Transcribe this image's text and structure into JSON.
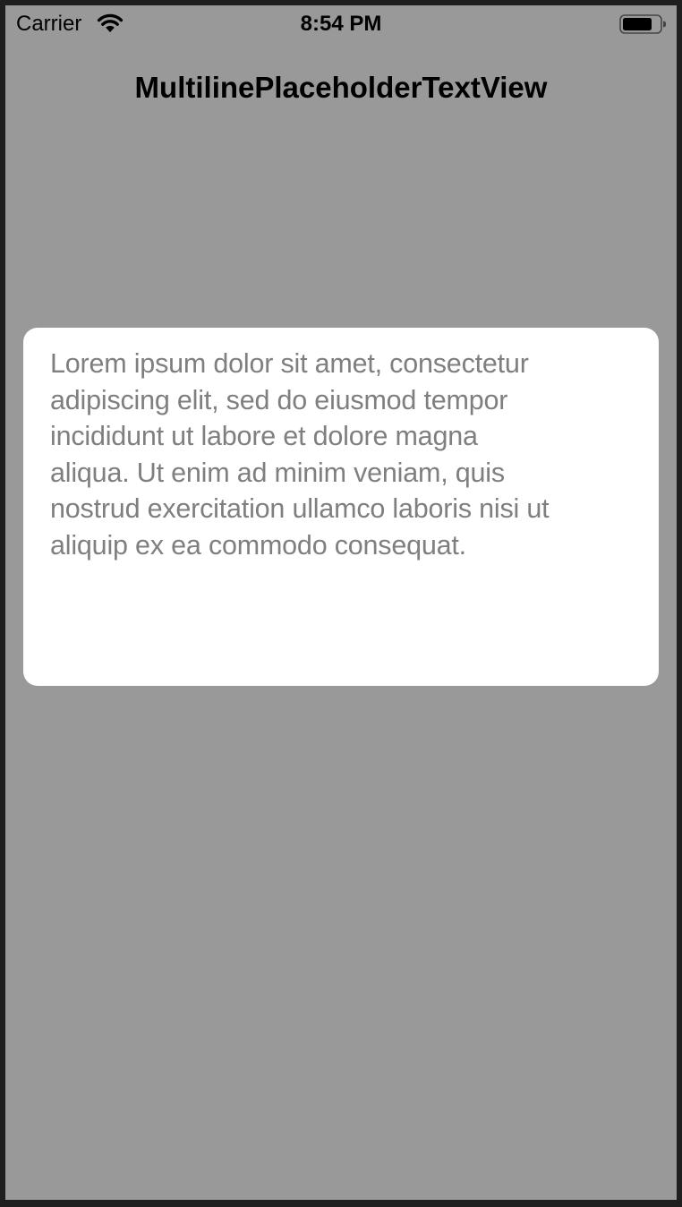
{
  "status_bar": {
    "carrier": "Carrier",
    "time": "8:54 PM",
    "wifi_icon": "wifi-icon",
    "battery_icon": "battery-icon"
  },
  "nav_bar": {
    "title": "MultilinePlaceholderTextView"
  },
  "text_view": {
    "text": "Lorem ipsum dolor sit amet, consectetur\nadipiscing elit, sed do eiusmod tempor\nincididunt ut labore et dolore magna\naliqua. Ut enim ad minim veniam, quis\nnostrud exercitation ullamco laboris nisi ut\naliquip ex ea commodo consequat."
  },
  "colors": {
    "background": "#999999",
    "text_view_background": "#ffffff",
    "placeholder_text": "#7f7f7f",
    "frame": "#1f1f1f"
  }
}
